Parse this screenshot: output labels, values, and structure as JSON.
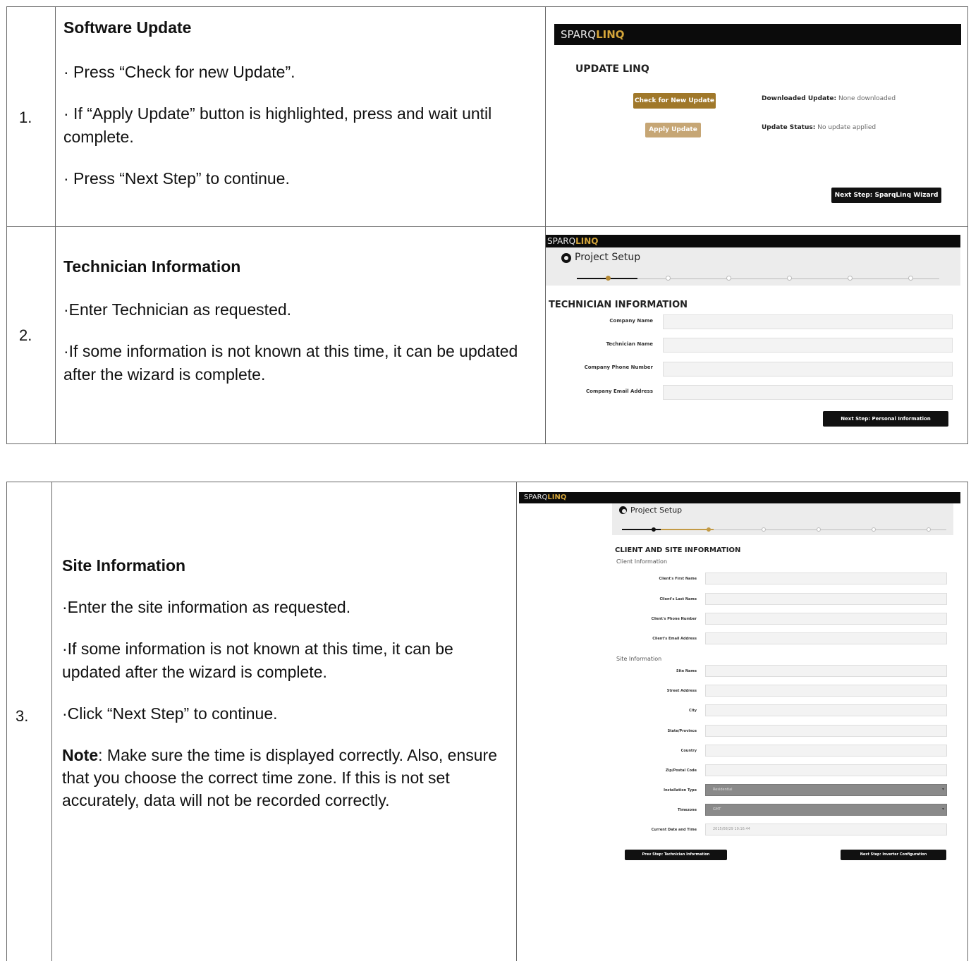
{
  "steps": [
    {
      "number": "1.",
      "title": "Software Update",
      "lines": [
        "· Press “Check for new Update”.",
        "· If “Apply Update” button is highlighted, press and wait until complete.",
        "·  Press “Next Step” to continue."
      ],
      "screenshot": {
        "brand_a": "SPARQ",
        "brand_b": "LINQ",
        "heading": "UPDATE LINQ",
        "check_button": "Check for New Update",
        "apply_button": "Apply Update",
        "downloaded_label": "Downloaded Update:",
        "downloaded_value": "None downloaded",
        "status_label": "Update Status:",
        "status_value": "No update applied",
        "next_button": "Next Step: SparqLinq Wizard"
      }
    },
    {
      "number": "2.",
      "title": "Technician Information",
      "lines": [
        "·Enter Technician as requested.",
        "·If some information is not known at this time, it can be updated after the wizard is complete."
      ],
      "screenshot": {
        "brand_a": "SPARQ",
        "brand_b": "LINQ",
        "setup_title": "Project Setup",
        "heading": "TECHNICIAN INFORMATION",
        "fields": [
          "Company Name",
          "Technician Name",
          "Company Phone Number",
          "Company Email Address"
        ],
        "next_button": "Next Step: Personal Information"
      }
    },
    {
      "number": "3.",
      "title": "Site Information",
      "lines": [
        "·Enter the site information as requested.",
        "·If some information is not known at this time, it can be updated after the wizard is complete.",
        "·Click “Next Step” to continue."
      ],
      "note_label": "Note",
      "note_text": ": Make sure the time is displayed correctly. Also, ensure that you choose the correct time zone. If this is not set accurately, data will not be recorded correctly.",
      "screenshot": {
        "brand_a": "SPARQ",
        "brand_b": "LINQ",
        "setup_title": "Project Setup",
        "heading": "CLIENT AND SITE INFORMATION",
        "client_section": "Client Information",
        "client_fields": [
          "Client's First Name",
          "Client's Last Name",
          "Client's Phone Number",
          "Client's Email Address"
        ],
        "site_section": "Site Information",
        "site_fields": [
          "Site Name",
          "Street Address",
          "City",
          "State/Province",
          "Country",
          "Zip/Postal Code"
        ],
        "install_label": "Installation Type",
        "install_value": "Residential",
        "timezone_label": "Timezone",
        "timezone_value": "GMT",
        "datetime_label": "Current Date and Time",
        "datetime_value": "2015/08/29 19:16:44",
        "prev_button": "Prev Step: Technician Information",
        "next_button": "Next Step: Inverter Configuration"
      }
    }
  ]
}
